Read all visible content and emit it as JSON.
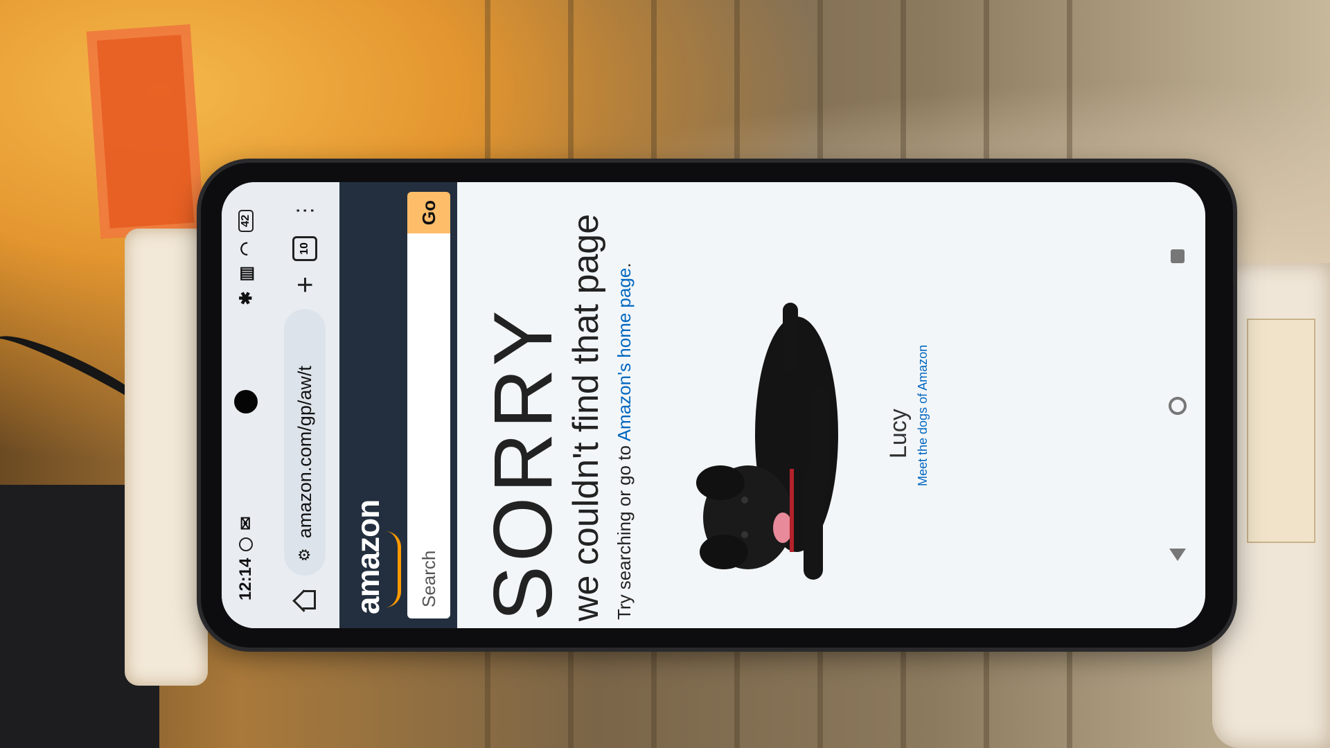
{
  "status": {
    "time": "12:14",
    "battery": "42"
  },
  "browser": {
    "url": "amazon.com/gp/aw/t",
    "tab_count": "10"
  },
  "amazon": {
    "logo": "amazon",
    "search_placeholder": "Search",
    "go_label": "Go"
  },
  "error": {
    "heading": "SORRY",
    "subheading": "we couldn't find that page",
    "body_prefix": "Try searching or go to ",
    "link": "Amazon's home page",
    "body_suffix": "."
  },
  "dog": {
    "name": "Lucy",
    "link": "Meet the dogs of Amazon"
  },
  "colors": {
    "amazon_dark": "#232f3e",
    "go_button": "#febd69",
    "link": "#0066c0",
    "smile": "#ff9900"
  },
  "icons": [
    "home-icon",
    "tune-icon",
    "plus-icon",
    "tabs-icon",
    "menu-icon",
    "back-icon",
    "home-nav-icon",
    "recents-icon"
  ]
}
